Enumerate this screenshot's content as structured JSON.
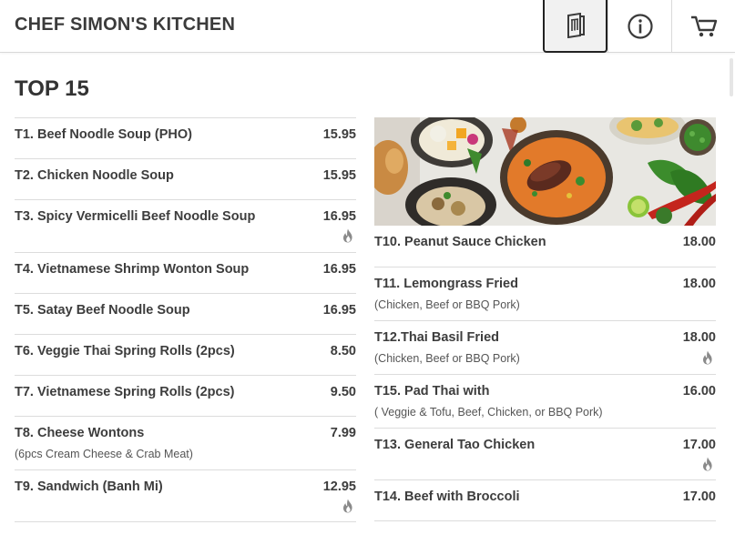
{
  "header": {
    "title": "CHEF SIMON'S KITCHEN",
    "icons": {
      "menu": "menu-book-icon",
      "info": "info-icon",
      "cart": "cart-icon"
    }
  },
  "section": {
    "title": "TOP 15"
  },
  "left_items": [
    {
      "name": "T1. Beef Noodle Soup (PHO)",
      "price": "15.95"
    },
    {
      "name": "T2. Chicken Noodle Soup",
      "price": "15.95"
    },
    {
      "name": "T3. Spicy Vermicelli Beef Noodle Soup",
      "price": "16.95",
      "spicy": true
    },
    {
      "name": "T4. Vietnamese Shrimp Wonton Soup",
      "price": "16.95"
    },
    {
      "name": "T5. Satay Beef Noodle Soup",
      "price": "16.95"
    },
    {
      "name": "T6. Veggie Thai Spring Rolls (2pcs)",
      "price": "8.50"
    },
    {
      "name": "T7. Vietnamese Spring Rolls (2pcs)",
      "price": "9.50"
    },
    {
      "name": "T8. Cheese Wontons",
      "price": "7.99",
      "desc": "(6pcs Cream Cheese & Crab Meat)"
    },
    {
      "name": "T9. Sandwich (Banh Mi)",
      "price": "12.95",
      "spicy": true
    }
  ],
  "right_items": [
    {
      "name": "T10. Peanut Sauce Chicken",
      "price": "18.00"
    },
    {
      "name": "T11. Lemongrass Fried",
      "price": "18.00",
      "desc": "(Chicken, Beef or BBQ Pork)"
    },
    {
      "name": "T12.Thai Basil Fried",
      "price": "18.00",
      "desc": "(Chicken, Beef or BBQ Pork)",
      "spicy": true
    },
    {
      "name": "T15. Pad Thai with",
      "price": "16.00",
      "desc": "( Veggie & Tofu, Beef, Chicken, or BBQ Pork)"
    },
    {
      "name": "T13. General Tao Chicken",
      "price": "17.00",
      "spicy": true
    },
    {
      "name": "T14. Beef with Broccoli",
      "price": "17.00"
    }
  ],
  "colors": {
    "text": "#3d3d3d",
    "divider": "#dcdcdc",
    "spicy_icon": "#8a8a8a"
  }
}
